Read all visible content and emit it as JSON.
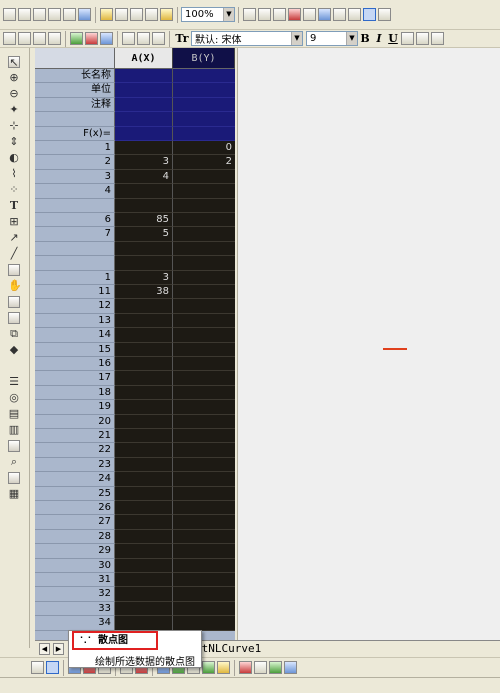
{
  "toolbar_top": {
    "zoom_value": "100%"
  },
  "toolbar_format": {
    "font_icon_label": "Tr",
    "font_value": "默认: 宋体",
    "size_value": "9",
    "bold_label": "B",
    "italic_label": "I",
    "underline_label": "U"
  },
  "worksheet": {
    "columns": [
      {
        "header": "A(X)"
      },
      {
        "header": "B(Y)"
      }
    ],
    "meta_rows": [
      {
        "label": "长名称"
      },
      {
        "label": "单位"
      },
      {
        "label": "注释"
      },
      {
        "label": ""
      },
      {
        "label": "F(x)="
      }
    ],
    "rows": [
      {
        "n": "1",
        "a": "",
        "b": "0"
      },
      {
        "n": "2",
        "a": "3",
        "b": "2"
      },
      {
        "n": "3",
        "a": "4",
        "b": ""
      },
      {
        "n": "4",
        "a": "",
        "b": ""
      },
      {
        "n": "",
        "a": "",
        "b": ""
      },
      {
        "n": "6",
        "a": "85",
        "b": ""
      },
      {
        "n": "7",
        "a": "5",
        "b": ""
      },
      {
        "n": "",
        "a": "",
        "b": ""
      },
      {
        "n": "",
        "a": "",
        "b": ""
      },
      {
        "n": "1",
        "a": "3",
        "b": ""
      },
      {
        "n": "11",
        "a": "38",
        "b": ""
      },
      {
        "n": "12",
        "a": "",
        "b": ""
      },
      {
        "n": "13",
        "a": "",
        "b": ""
      },
      {
        "n": "14",
        "a": "",
        "b": ""
      },
      {
        "n": "15",
        "a": "",
        "b": ""
      },
      {
        "n": "16",
        "a": "",
        "b": ""
      },
      {
        "n": "17",
        "a": "",
        "b": ""
      },
      {
        "n": "18",
        "a": "",
        "b": ""
      },
      {
        "n": "19",
        "a": "",
        "b": ""
      },
      {
        "n": "20",
        "a": "",
        "b": ""
      },
      {
        "n": "21",
        "a": "",
        "b": ""
      },
      {
        "n": "22",
        "a": "",
        "b": ""
      },
      {
        "n": "23",
        "a": "",
        "b": ""
      },
      {
        "n": "24",
        "a": "",
        "b": ""
      },
      {
        "n": "25",
        "a": "",
        "b": ""
      },
      {
        "n": "26",
        "a": "",
        "b": ""
      },
      {
        "n": "27",
        "a": "",
        "b": ""
      },
      {
        "n": "28",
        "a": "",
        "b": ""
      },
      {
        "n": "29",
        "a": "",
        "b": ""
      },
      {
        "n": "30",
        "a": "",
        "b": ""
      },
      {
        "n": "31",
        "a": "",
        "b": ""
      },
      {
        "n": "32",
        "a": "",
        "b": ""
      },
      {
        "n": "33",
        "a": "",
        "b": ""
      },
      {
        "n": "34",
        "a": "",
        "b": ""
      }
    ]
  },
  "sheet_tabs": {
    "active_tab": "itNLCurve1"
  },
  "popup": {
    "item_label": "散点图",
    "description": "绘制所选数据的散点图"
  }
}
